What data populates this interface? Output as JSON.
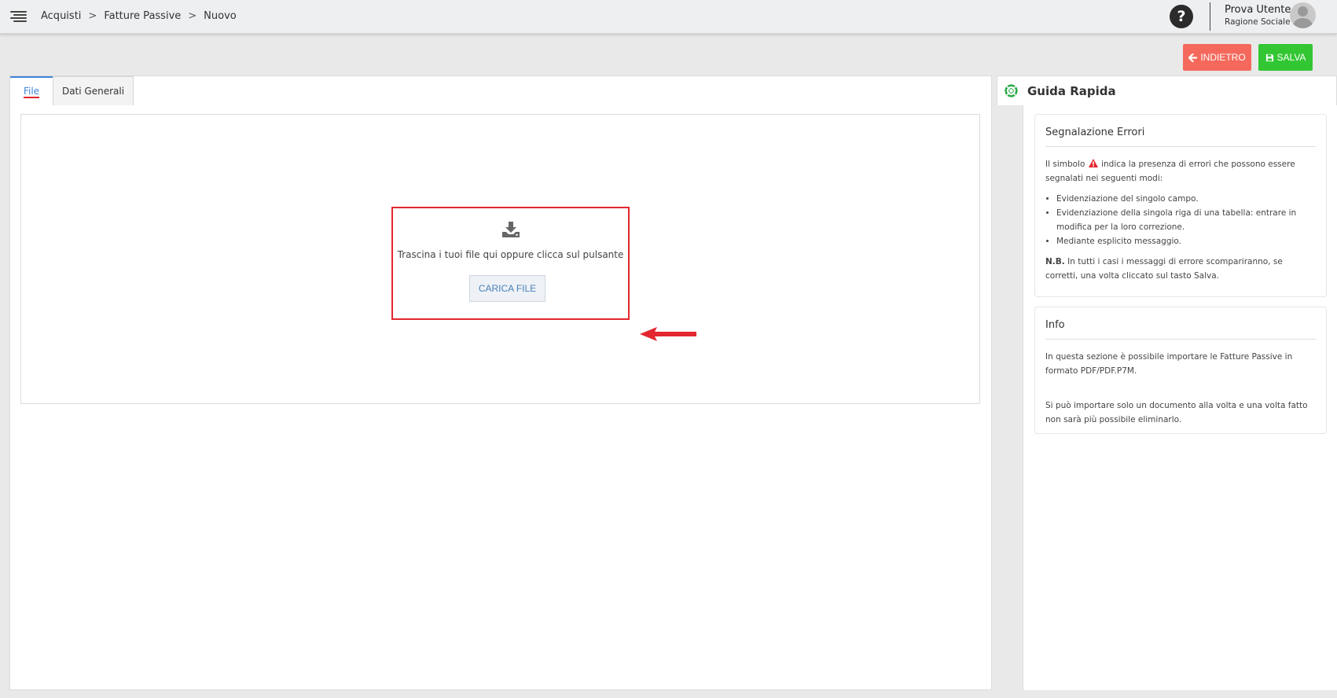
{
  "breadcrumb": {
    "items": [
      "Acquisti",
      "Fatture Passive",
      "Nuovo"
    ],
    "separator": ">"
  },
  "user": {
    "name": "Prova Utente",
    "company": "Ragione Sociale"
  },
  "help": {
    "symbol": "?"
  },
  "actions": {
    "back_label": "INDIETRO",
    "save_label": "SALVA"
  },
  "tabs": [
    {
      "label": "File",
      "active": true
    },
    {
      "label": "Dati Generali",
      "active": false
    }
  ],
  "upload": {
    "instruction": "Trascina i tuoi file qui oppure clicca sul pulsante",
    "button_label": "CARICA FILE"
  },
  "guide": {
    "title": "Guida Rapida",
    "errors_card": {
      "title": "Segnalazione Errori",
      "intro_before": "Il simbolo",
      "intro_after": "indica la presenza di errori che possono essere segnalati nei seguenti modi:",
      "items": [
        "Evidenziazione del singolo campo.",
        "Evidenziazione della singola riga di una tabella: entrare in modifica per la loro correzione.",
        "Mediante esplicito messaggio."
      ],
      "note_label": "N.B.",
      "note_text": "In tutti i casi i messaggi di errore scompariranno, se corretti, una volta cliccato sul tasto Salva."
    },
    "info_card": {
      "title": "Info",
      "paragraph1": "In questa sezione è possibile importare le Fatture Passive in formato PDF/PDF.P7M.",
      "paragraph2": "Si può importare solo un documento alla volta e una volta fatto non sarà più possibile eliminarlo."
    }
  },
  "colors": {
    "back_button": "#f4695c",
    "save_button": "#33c633",
    "active_tab": "#3f83d6",
    "highlight": "#e3262f",
    "guide_icon": "#2eaa4a"
  }
}
